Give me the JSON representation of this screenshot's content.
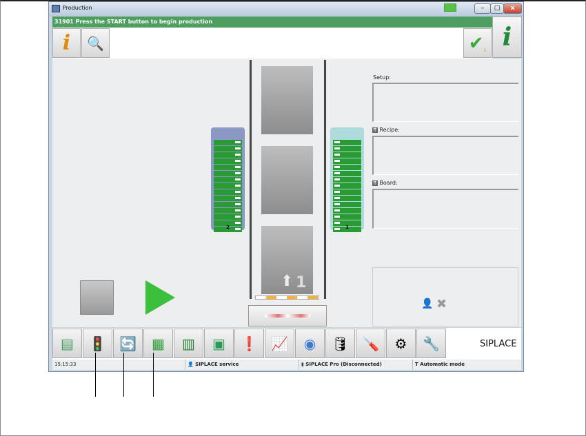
{
  "window": {
    "title": "Production",
    "minimize": "–",
    "maximize": "□",
    "close": "x"
  },
  "message": "31901 Press the START button to begin production",
  "toolbar": {
    "check_badge": "1"
  },
  "feeders": {
    "left_label": "2",
    "right_label": "1"
  },
  "board_indicator": "1",
  "panels": {
    "setup": "Setup:",
    "recipe": "Recipe:",
    "board": "Board:"
  },
  "bottom": {
    "brand": "SIPLACE"
  },
  "status": {
    "time": "15:15:33",
    "service": "SIPLACE service",
    "pro": "SIPLACE Pro (Disconnected)",
    "mode": "Automatic mode"
  },
  "colors": {
    "message_bar": "#4e9e5f",
    "feeder_left": "#8c98c4",
    "feeder_right": "#aedcdc",
    "slot": "#2a9a35"
  }
}
